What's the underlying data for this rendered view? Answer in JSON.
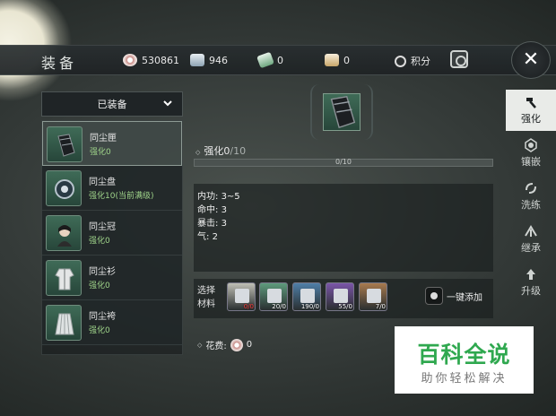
{
  "header": {
    "title": "装备",
    "currencies": [
      {
        "icon": "coin-icon",
        "value": "530861"
      },
      {
        "icon": "silver-icon",
        "value": "946"
      },
      {
        "icon": "jade-icon",
        "value": "0"
      },
      {
        "icon": "scroll-icon",
        "value": "0"
      }
    ],
    "points_label": "积分",
    "close_symbol": "✕"
  },
  "filter": {
    "selected": "已装备",
    "chevron": "⌄"
  },
  "equipment": [
    {
      "name": "同尘匣",
      "level": "强化0",
      "icon": "gauntlet-icon",
      "selected": true
    },
    {
      "name": "同尘盘",
      "level": "强化10(当前满级)",
      "icon": "disc-icon",
      "selected": false
    },
    {
      "name": "同尘冠",
      "level": "强化0",
      "icon": "portrait-icon",
      "selected": false
    },
    {
      "name": "同尘衫",
      "level": "强化0",
      "icon": "robe-icon",
      "selected": false
    },
    {
      "name": "同尘袴",
      "level": "强化0",
      "icon": "skirt-icon",
      "selected": false
    }
  ],
  "enhance": {
    "label": "强化",
    "current": "0",
    "max": "/10",
    "progress_text": "0/10",
    "progress": 0.0
  },
  "stats": [
    {
      "label": "内功: ",
      "value": "3~5"
    },
    {
      "label": "命中: ",
      "value": "3"
    },
    {
      "label": "暴击: ",
      "value": "3"
    },
    {
      "label": "气: ",
      "value": "2"
    }
  ],
  "materials": {
    "label": "选择材料",
    "items": [
      {
        "count": "0/0",
        "color": "#bfbfb5",
        "warn": true
      },
      {
        "count": "20/0",
        "color": "#5e9a7c",
        "warn": false
      },
      {
        "count": "190/0",
        "color": "#4f7fa8",
        "warn": false
      },
      {
        "count": "55/0",
        "color": "#7a55a8",
        "warn": false
      },
      {
        "count": "7/0",
        "color": "#a87a4f",
        "warn": false
      }
    ],
    "auto_add": "一键添加"
  },
  "cost": {
    "label": "花费:",
    "value": "0"
  },
  "tabs": [
    {
      "label": "强化",
      "icon": "hammer-icon",
      "active": true
    },
    {
      "label": "镶嵌",
      "icon": "gem-icon",
      "active": false
    },
    {
      "label": "洗练",
      "icon": "refine-icon",
      "active": false
    },
    {
      "label": "继承",
      "icon": "inherit-icon",
      "active": false
    },
    {
      "label": "升级",
      "icon": "upgrade-icon",
      "active": false
    }
  ],
  "watermark": {
    "title": "百科全说",
    "subtitle": "助你轻松解决"
  }
}
